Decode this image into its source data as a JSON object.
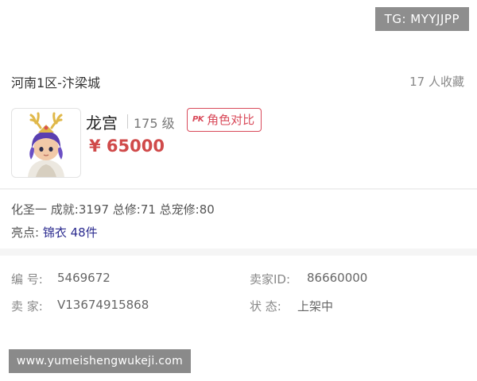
{
  "watermark_top": "TG: MYYJJPP",
  "server": {
    "name": "河南1区-汴梁城",
    "favorites": "17 人收藏"
  },
  "character": {
    "name": "龙宫",
    "level": "175 级",
    "compare_icon": "PK",
    "compare_label": "角色对比",
    "price": "¥ 65000"
  },
  "stats": {
    "text": "化圣一 成就:3197 总修:71 总宠修:80"
  },
  "highlights": {
    "label": "亮点: ",
    "value": "锦衣 48件"
  },
  "listing": {
    "id_label": "编 号:",
    "id_value": "5469672",
    "seller_id_label": "卖家ID:",
    "seller_id_value": "86660000",
    "seller_label": "卖 家:",
    "seller_value": "V13674915868",
    "status_label": "状 态:",
    "status_value": "上架中"
  },
  "watermark_bottom": "www.yumeishengwukeji.com",
  "colors": {
    "price_red": "#d04a4a",
    "compare_red": "#d94a5a",
    "highlight_blue": "#2b2b8f"
  }
}
